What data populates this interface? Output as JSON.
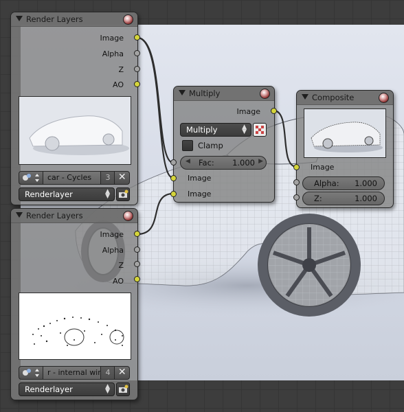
{
  "render_layers_1": {
    "title": "Render Layers",
    "outputs": [
      "Image",
      "Alpha",
      "Z",
      "AO"
    ],
    "scene_name": "car - Cycles",
    "scene_users": "3",
    "layer": "Renderlayer"
  },
  "render_layers_2": {
    "title": "Render Layers",
    "outputs": [
      "Image",
      "Alpha",
      "Z",
      "AO"
    ],
    "scene_name": "r - internal wire",
    "scene_users": "4",
    "layer": "Renderlayer"
  },
  "multiply": {
    "title": "Multiply",
    "output": "Image",
    "blend_mode": "Multiply",
    "clamp_label": "Clamp",
    "fac_label": "Fac:",
    "fac_value": "1.000",
    "inputs": [
      "Image",
      "Image"
    ]
  },
  "composite": {
    "title": "Composite",
    "image_label": "Image",
    "alpha_label": "Alpha:",
    "alpha_value": "1.000",
    "z_label": "Z:",
    "z_value": "1.000"
  },
  "icons": {
    "node_toggle": "triangle-down-icon",
    "node_preview": "sphere-icon",
    "scene_browse": "scene-browse-icon",
    "unlink": "x-icon",
    "render_layer": "camera-render-icon",
    "checker": "checker-icon"
  },
  "colors": {
    "socket_color": "#d4d43a",
    "socket_value": "#a3a3a3",
    "node_bg": "#808080",
    "grid_bg": "#3d3d3d"
  }
}
